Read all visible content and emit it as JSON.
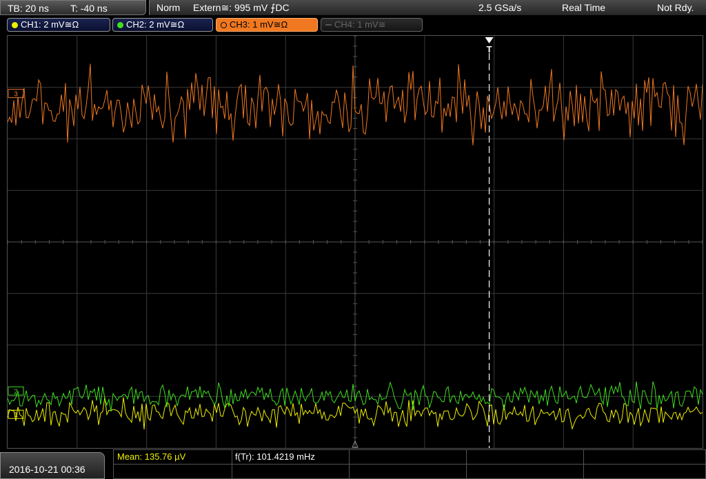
{
  "header": {
    "timebase": "TB: 20 ns",
    "trigger_time": "T: -40 ns",
    "mode": "Norm",
    "trigger_source": "Extern≅: 995 mV ⨍DC",
    "sample_rate": "2.5 GSa/s",
    "acquisition": "Real Time",
    "status": "Not Rdy."
  },
  "channels": [
    {
      "label": "CH1: 2 mV≅Ω",
      "color": "#f0f000",
      "state": "on"
    },
    {
      "label": "CH2: 2 mV≅Ω",
      "color": "#40e020",
      "state": "on"
    },
    {
      "label": "CH3: 1 mV≅Ω",
      "color": "#f07820",
      "state": "active"
    },
    {
      "label": "CH4: 1 mV≅",
      "color": "#666666",
      "state": "off"
    }
  ],
  "markers": {
    "ch3": "3",
    "ch2": "2",
    "ch1": "1",
    "trigger": "T"
  },
  "measurements": {
    "mean": "Mean: 135.76 µV",
    "freq": "f(Tr): 101.4219 mHz"
  },
  "footer": {
    "datetime": "2016-10-21 00:36"
  },
  "colors": {
    "ch1": "#f0f000",
    "ch2": "#40e020",
    "ch3": "#f07820",
    "grid": "#3a3a3a"
  }
}
